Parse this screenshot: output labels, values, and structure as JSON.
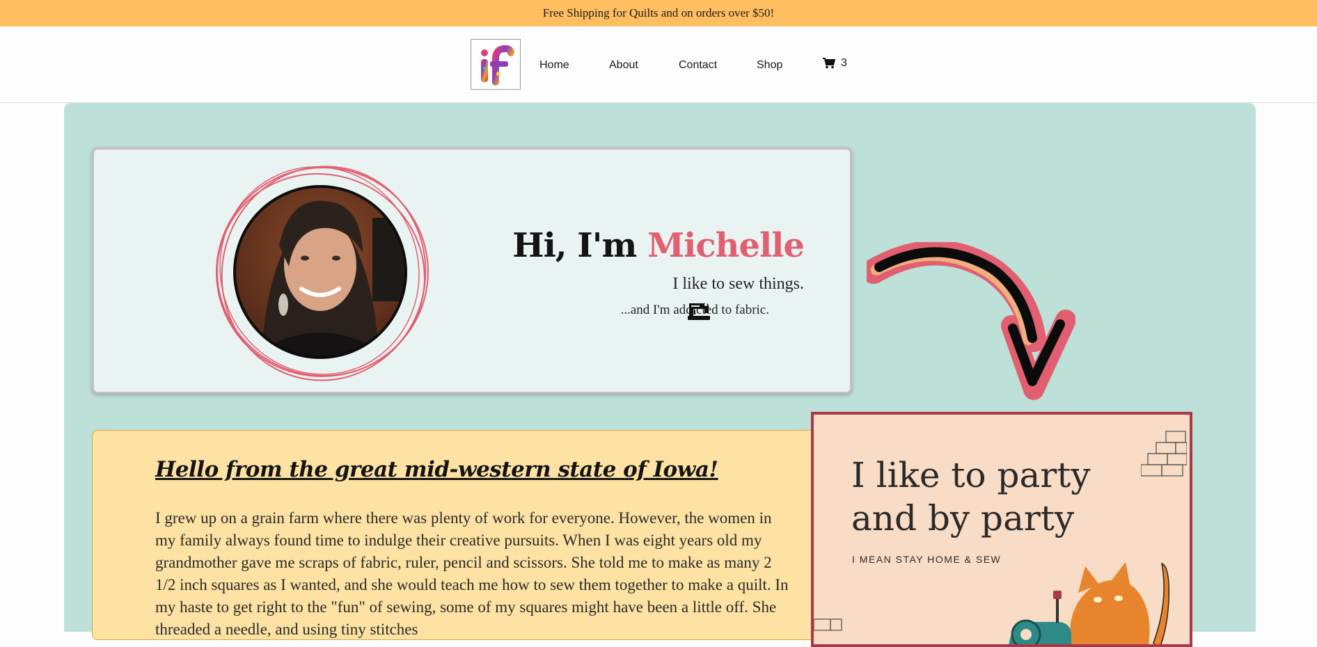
{
  "promo_text": "Free Shipping for Quilts and on orders over $50!",
  "logo_text": "if",
  "nav": {
    "home": "Home",
    "about": "About",
    "contact": "Contact",
    "shop": "Shop",
    "cart_count": "3"
  },
  "hero": {
    "greeting": "Hi, I'm",
    "name": "Michelle",
    "line1": "I like to sew things.",
    "line2": "...and I'm addicted to fabric."
  },
  "story": {
    "heading": "Hello from the great mid-western state of Iowa!",
    "body": "I grew up on a grain farm where there was plenty of work for everyone. However, the women in my family always found time to indulge their creative pursuits. When I was eight years old my grandmother gave me scraps of fabric, ruler, pencil and scissors. She told me to make as many 2 1/2 inch squares as I wanted, and she would teach me how to sew them together to make a quilt. In my haste to get right to the \"fun\" of sewing, some of my squares might have been a little off. She threaded a needle, and using tiny stitches"
  },
  "party": {
    "line1": "I like to party",
    "line2": "and by party",
    "line3": "I MEAN STAY HOME & SEW"
  },
  "colors": {
    "promo_bg": "#ffbf60",
    "main_bg": "#bde0d9",
    "hero_bg": "#e9f4f2",
    "accent": "#e15f70",
    "story_bg": "#fde2a3",
    "party_bg": "#f8dcc6",
    "party_border": "#a8384a"
  },
  "icons": [
    "cart-icon",
    "sewing-machine-icon",
    "arrow-icon",
    "portrait-photo"
  ]
}
